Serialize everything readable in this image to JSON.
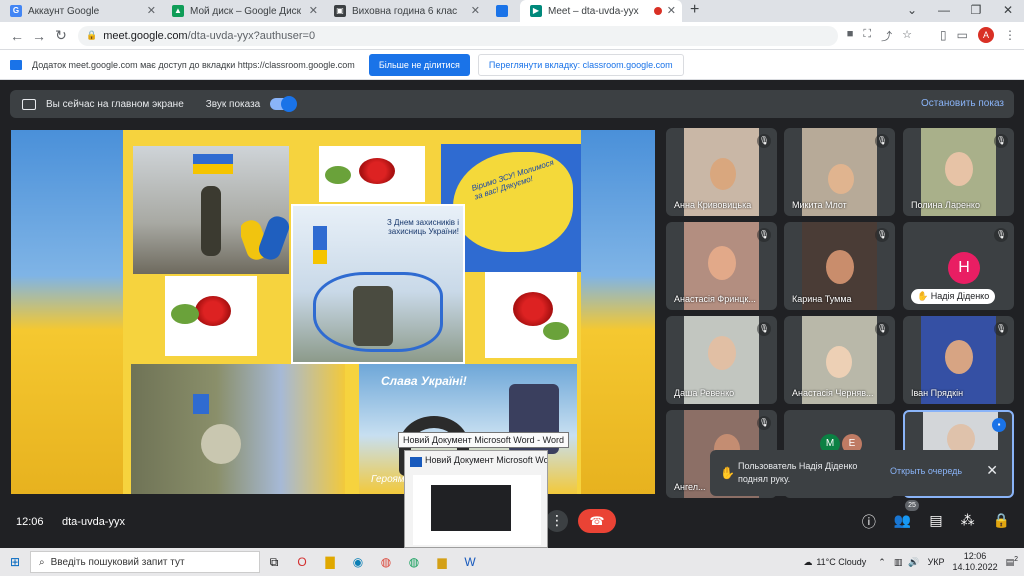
{
  "browser": {
    "tabs": [
      {
        "label": "Аккаунт Google",
        "icon": "google-icon",
        "color": "#4285f4"
      },
      {
        "label": "Мой диск – Google Диск",
        "icon": "drive-icon",
        "color": "#0f9d58"
      },
      {
        "label": "Виховна година 6 клас",
        "icon": "slides-icon",
        "color": "#3c4043"
      },
      {
        "label": "",
        "icon": "cast-icon",
        "color": "#1a73e8"
      },
      {
        "label": "Meet – dta-uvda-yyx",
        "icon": "meet-icon",
        "color": "#00897b"
      }
    ],
    "new_tab": "+",
    "url_host": "meet.google.com",
    "url_path": "/dta-uvda-yyx?authuser=0",
    "profile_initial": "A"
  },
  "infobar": {
    "message": "Додаток meet.google.com має доступ до вкладки https://classroom.google.com",
    "stop_sharing": "Більше не ділитися",
    "view_tab": "Переглянути вкладку: classroom.google.com"
  },
  "sharebar": {
    "status": "Вы сейчас на главном экране",
    "sound_label": "Звук показа",
    "stop_label": "Остановить показ"
  },
  "collage": {
    "poster_text": "З Днем захисників і захисниць України!",
    "dove_text": "Віримо ЗСУ! Молимося за вас! Дякуємо!",
    "glory_text": "Слава Україні!",
    "hero_text": "Героям"
  },
  "participants": [
    {
      "name": "Анна Кривовицька",
      "skin": "#d9a77e",
      "bg": "#c9b7a6"
    },
    {
      "name": "Микита Млот",
      "skin": "#e0b48f",
      "bg": "#b7aa98"
    },
    {
      "name": "Полина Ларенко",
      "skin": "#e7c3a6",
      "bg": "#a9b08a"
    },
    {
      "name": "Анастасія Фринцк...",
      "skin": "#e2a989",
      "bg": "#b38e80"
    },
    {
      "name": "Карина Тумма",
      "skin": "#c98d6c",
      "bg": "#4a3c36"
    },
    {
      "name": "Надія Діденко",
      "initial": "Н",
      "bg": "#3c4043"
    },
    {
      "name": "Даша Ревенко",
      "skin": "#e1bfa4",
      "bg": "#c2c6c0"
    },
    {
      "name": "Анастасія Черняв...",
      "skin": "#edd0b5",
      "bg": "#b9b8a9"
    },
    {
      "name": "Іван Прядкін",
      "skin": "#d7a483",
      "bg": "#3550a4"
    },
    {
      "name": "Ангел...",
      "skin": "#c48d72",
      "bg": "#8c6f66"
    },
    {
      "name": "",
      "initials": [
        "M",
        "E"
      ],
      "bg": "#3c4043"
    },
    {
      "name": "",
      "skin": "#dfc2ab",
      "bg": "#d3d6d9"
    }
  ],
  "toast": {
    "message": "Пользователь Надія Діденко поднял руку.",
    "action": "Открыть очередь"
  },
  "controls": {
    "time": "12:06",
    "meeting_code": "dta-uvda-yyx",
    "participant_count": "25"
  },
  "word_preview": {
    "tooltip": "Новий Документ Microsoft Word - Word",
    "title": "Новий Документ Microsoft Wo..."
  },
  "taskbar": {
    "search_placeholder": "Введіть пошуковий запит тут",
    "weather": "11°C Cloudy",
    "language": "УКР",
    "clock_time": "12:06",
    "clock_date": "14.10.2022",
    "notification_count": "2"
  }
}
